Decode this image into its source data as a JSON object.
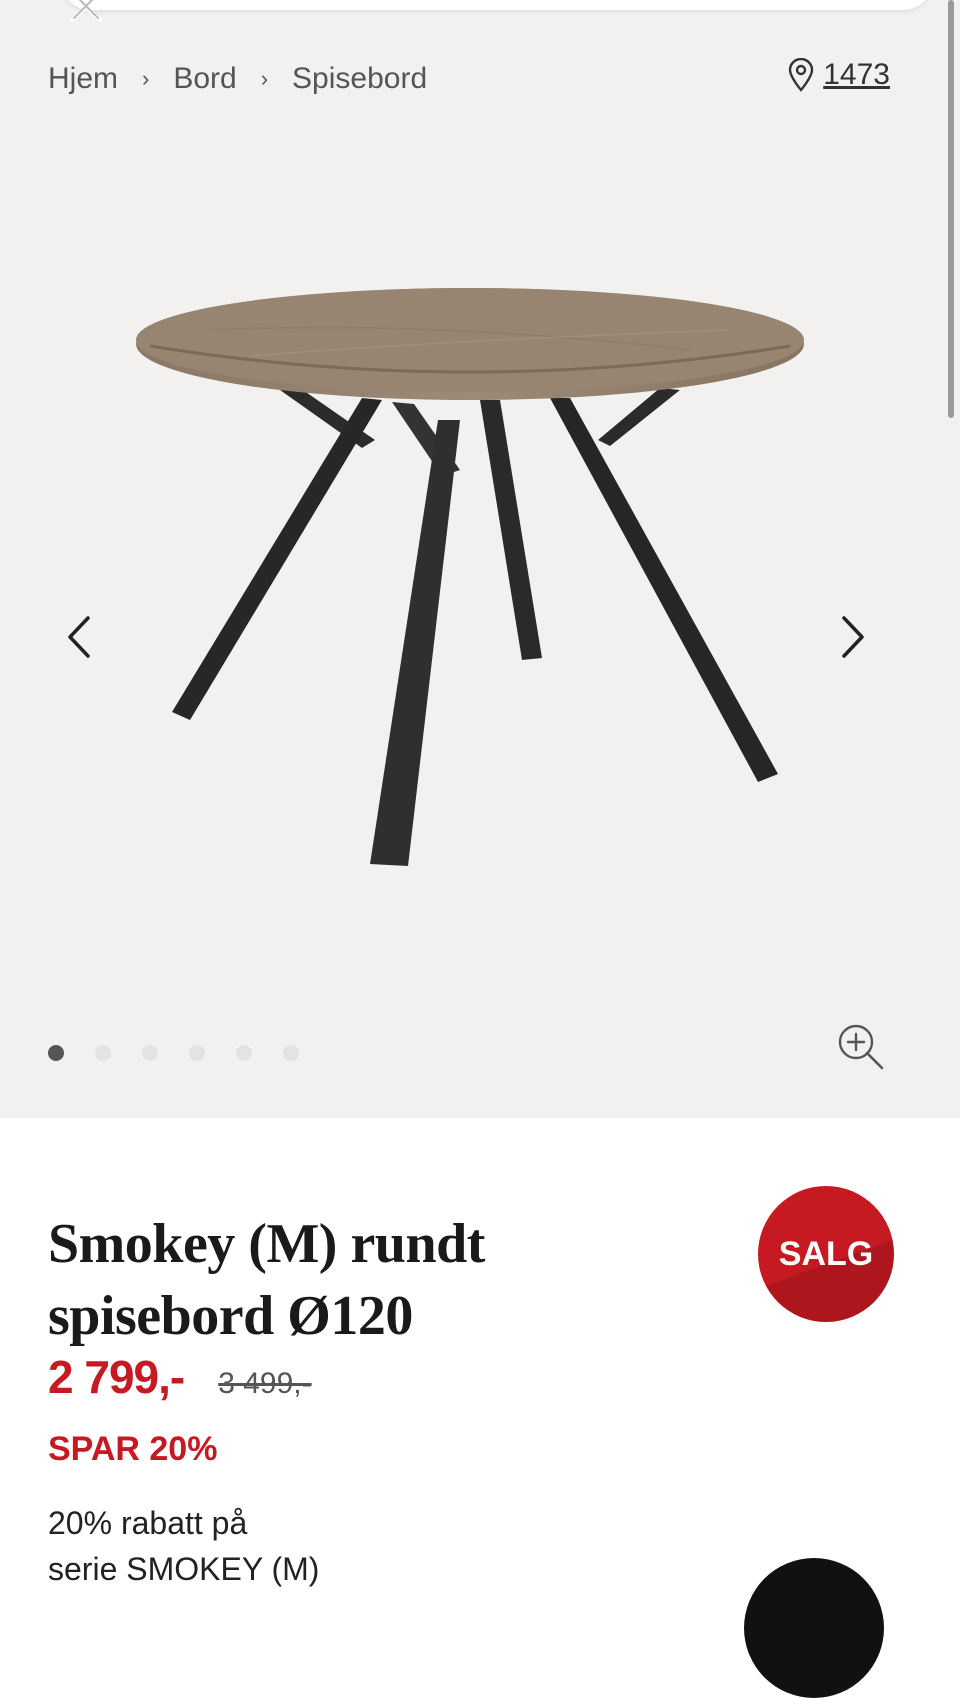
{
  "breadcrumb": {
    "items": [
      "Hjem",
      "Bord",
      "Spisebord"
    ],
    "separator": "›"
  },
  "store": {
    "icon": "location-pin-icon",
    "number": "1473"
  },
  "gallery": {
    "image_count": 6,
    "active_index": 0
  },
  "product": {
    "title_line1": "Smokey (M) rundt",
    "title_line2": "spisebord Ø120",
    "badge": "SALG",
    "price": "2 799,-",
    "old_price": "3 499,-",
    "save": "SPAR 20%",
    "promo_line1": "20% rabatt på",
    "promo_line2": "serie SMOKEY (M)"
  },
  "colors": {
    "accent_red": "#c61922",
    "gallery_bg": "#f2f1ef"
  }
}
